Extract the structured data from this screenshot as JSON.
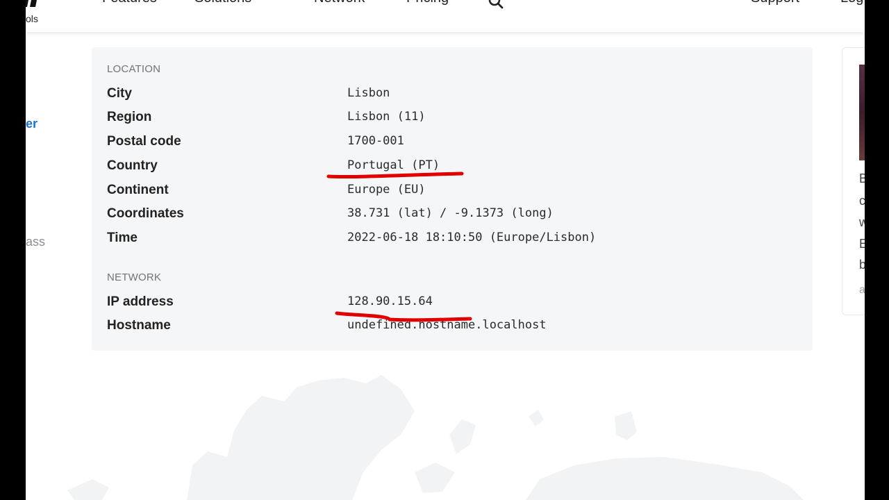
{
  "nav": {
    "logo_subtext": "ols",
    "items": [
      "Features",
      "Solutions",
      "Network",
      "Pricing",
      "Support",
      "Log"
    ]
  },
  "sidebar": {
    "link_fragment": "er",
    "text_fragment": "ass"
  },
  "location": {
    "section_title": "LOCATION",
    "rows": [
      {
        "label": "City",
        "value": "Lisbon"
      },
      {
        "label": "Region",
        "value": "Lisbon (11)"
      },
      {
        "label": "Postal code",
        "value": "1700-001"
      },
      {
        "label": "Country",
        "value": "Portugal (PT)"
      },
      {
        "label": "Continent",
        "value": "Europe (EU)"
      },
      {
        "label": "Coordinates",
        "value": "38.731 (lat) / -9.1373 (long)"
      },
      {
        "label": "Time",
        "value": "2022-06-18 18:10:50 (Europe/Lisbon)"
      }
    ]
  },
  "network": {
    "section_title": "NETWORK",
    "rows": [
      {
        "label": "IP address",
        "value": "128.90.15.64"
      },
      {
        "label": "Hostname",
        "value": "undefined.hostname.localhost"
      }
    ]
  },
  "ad": {
    "lines": [
      "B",
      "c",
      "w",
      "E",
      "b"
    ],
    "meta": "a"
  },
  "colors": {
    "accent_link": "#1a73c8",
    "annotation_red": "#e00000",
    "card_bg": "#f5f6f7"
  },
  "icons": [
    "search-icon",
    "chevron-down-icon",
    "logo-mark"
  ]
}
